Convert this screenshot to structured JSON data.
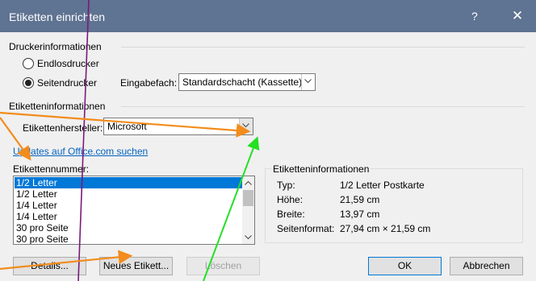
{
  "window": {
    "title": "Etiketten einrichten",
    "help_glyph": "?",
    "close_glyph": "✕"
  },
  "printer": {
    "group_label": "Druckerinformationen",
    "continuous_label": "Endlosdrucker",
    "page_label": "Seitendrucker",
    "tray_label": "Eingabefach:",
    "tray_value": "Standardschacht (Kassette)"
  },
  "label_info": {
    "group_label": "Etiketteninformationen",
    "vendor_label": "Etikettenhersteller:",
    "vendor_value": "Microsoft",
    "updates_link": "Updates auf Office.com suchen",
    "number_label": "Etikettennummer:",
    "items": [
      "1/2 Letter",
      "1/2 Letter",
      "1/4 Letter",
      "1/4 Letter",
      "30 pro Seite",
      "30 pro Seite"
    ],
    "selected_index": 0
  },
  "details": {
    "group_label": "Etiketteninformationen",
    "rows": [
      {
        "key": "Typ:",
        "value": "1/2 Letter Postkarte"
      },
      {
        "key": "Höhe:",
        "value": "21,59 cm"
      },
      {
        "key": "Breite:",
        "value": "13,97 cm"
      },
      {
        "key": "Seitenformat:",
        "value": "27,94 cm × 21,59 cm"
      }
    ]
  },
  "buttons": {
    "details": "Details...",
    "new_label": "Neues Etikett...",
    "delete": "Löschen",
    "ok": "OK",
    "cancel": "Abbrechen"
  },
  "annotation_colors": {
    "orange": "#f28c1c",
    "purple": "#7a1a7a",
    "green": "#22e022"
  }
}
